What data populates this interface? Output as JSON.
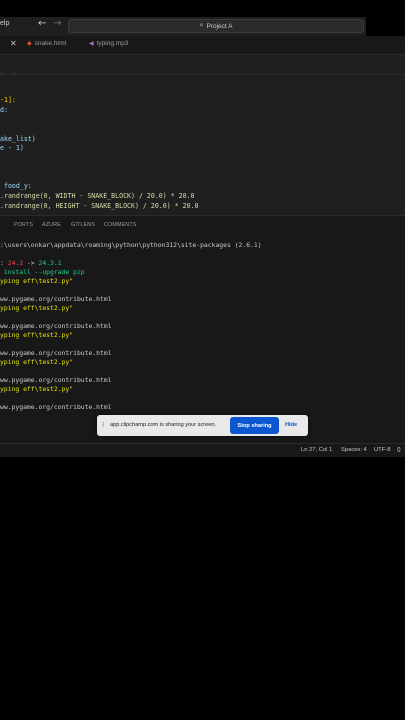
{
  "titlebar": {
    "menu_label": "elp",
    "nav_back": "←",
    "nav_forward": "→",
    "search_icon": "⌕",
    "command_center": "Project A"
  },
  "tabs": [
    {
      "label": "snake.html",
      "icon": "html-file-icon",
      "close": "✕"
    },
    {
      "label": "typing.mp3",
      "icon": "audio-file-icon"
    }
  ],
  "editor": {
    "lines": [
      "_  _",
      "-1]:",
      "d:",
      "ake_list)",
      "e - 1)",
      " food_y:",
      ".randrange(0, WIDTH - SNAKE_BLOCK) / 20.0) * 20.0",
      ".randrange(0, HEIGHT - SNAKE_BLOCK) / 20.0) * 20.0"
    ]
  },
  "panel": {
    "tabs": [
      "PORTS",
      "AZURE",
      "GITLENS",
      "COMMENTS"
    ]
  },
  "terminal": {
    "path_line": ":\\users\\onkar\\appdata\\roaming\\python\\python312\\site-packages (2.6.1)",
    "notice_prefix": ":",
    "version_old": "24.2",
    "version_arrow": " -> ",
    "version_new": "24.3.1",
    "install_cmd": " install --upgrade pip",
    "run_line": "yping eff\\test2.py\"",
    "contribute_line": "ww.pygame.org/contribute.html"
  },
  "share_bar": {
    "grip": "⁞",
    "message": "app.clipchamp.com is sharing your screen.",
    "stop_label": "Stop sharing",
    "hide_label": "Hide"
  },
  "status": {
    "position": "Ln 27, Col 1",
    "indent": "Spaces: 4",
    "encoding": "UTF-8",
    "brackets": "{}"
  },
  "colors": {
    "accent_blue": "#0b57d0",
    "terminal_red": "#f14c4c",
    "terminal_green": "#23d18b",
    "terminal_yellow": "#e5e510"
  }
}
